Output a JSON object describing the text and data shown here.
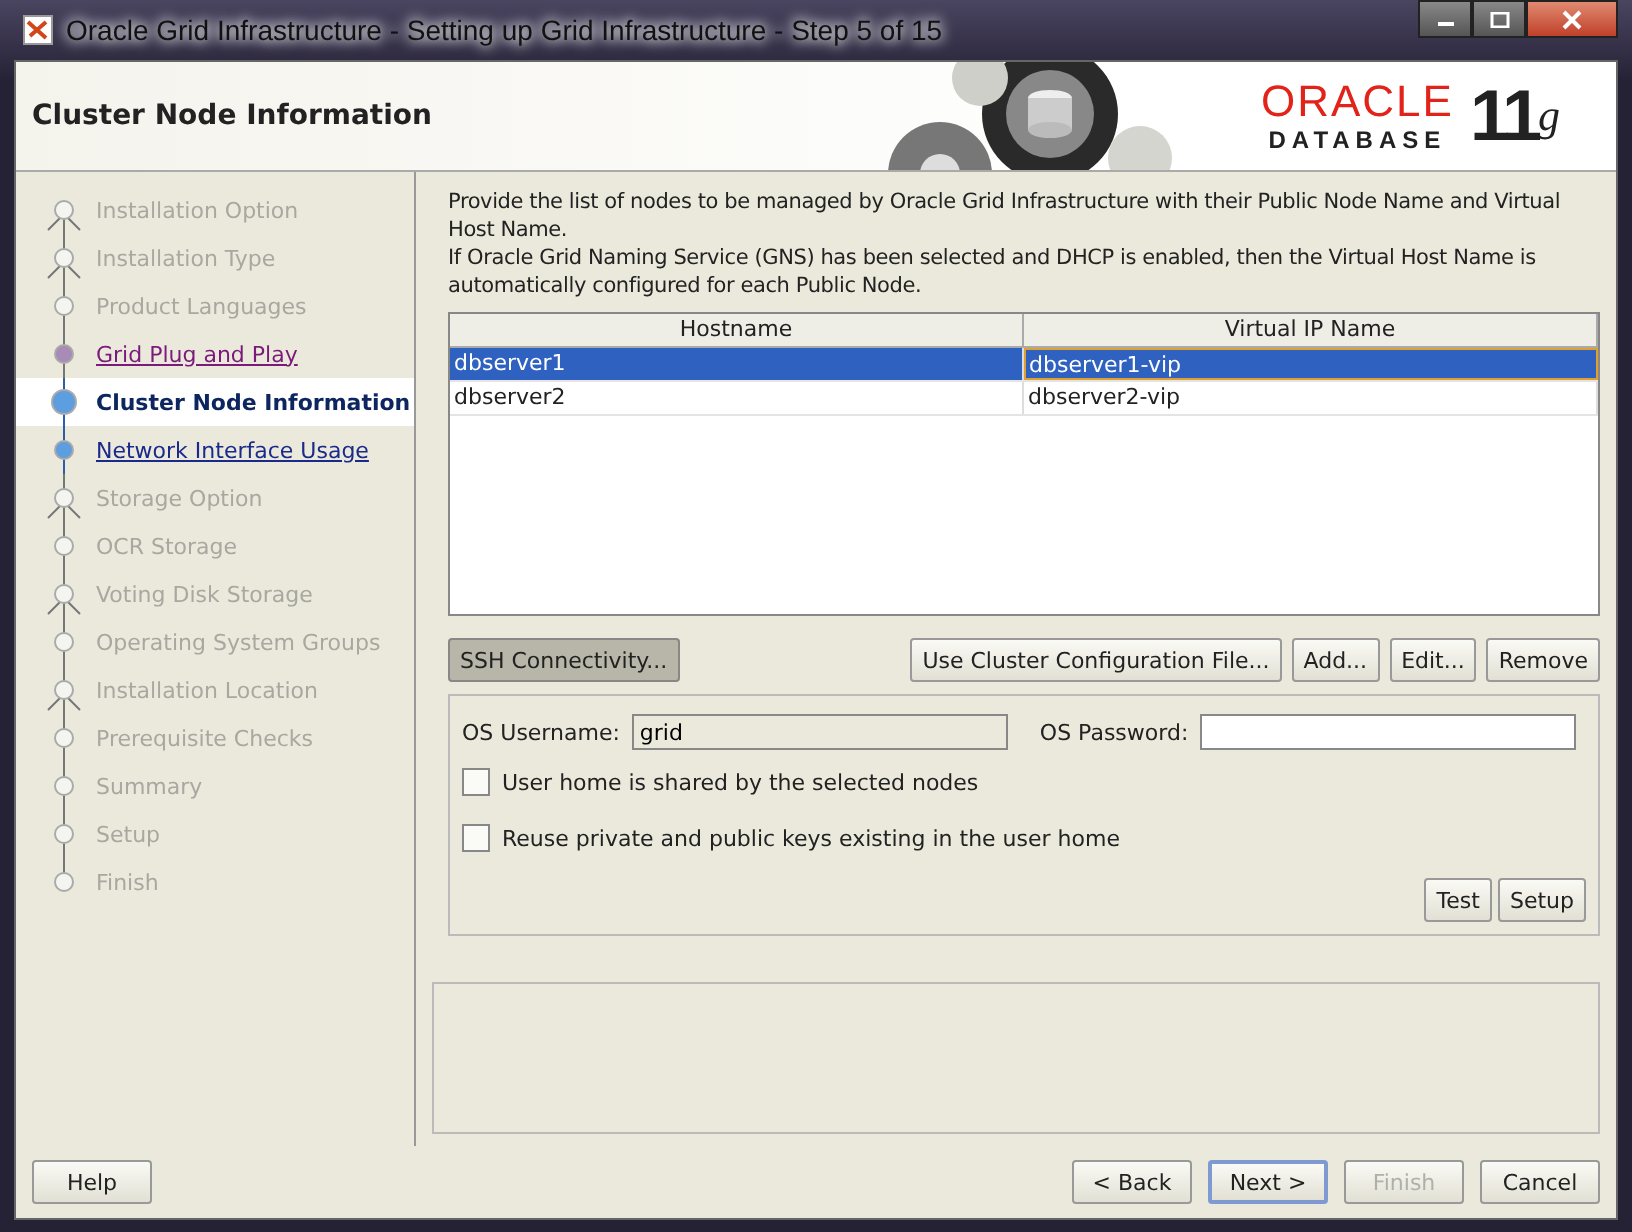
{
  "window": {
    "title": "Oracle Grid Infrastructure - Setting up Grid Infrastructure - Step 5 of 15"
  },
  "header": {
    "title": "Cluster Node Information",
    "logo_brand": "ORACLE",
    "logo_product": "DATABASE",
    "logo_version": "11",
    "logo_suffix": "g"
  },
  "steps": [
    {
      "label": "Installation Option",
      "selected": false,
      "visited": false,
      "enabled": false,
      "kind": "branch"
    },
    {
      "label": "Installation Type",
      "selected": false,
      "visited": false,
      "enabled": false,
      "kind": "branch"
    },
    {
      "label": "Product Languages",
      "selected": false,
      "visited": false,
      "enabled": false,
      "kind": "step"
    },
    {
      "label": "Grid Plug and Play",
      "selected": false,
      "visited": true,
      "enabled": true,
      "kind": "step"
    },
    {
      "label": "Cluster Node Information",
      "selected": true,
      "visited": false,
      "enabled": true,
      "kind": "step"
    },
    {
      "label": "Network Interface Usage",
      "selected": false,
      "visited": false,
      "enabled": true,
      "kind": "step"
    },
    {
      "label": "Storage Option",
      "selected": false,
      "visited": false,
      "enabled": false,
      "kind": "branch"
    },
    {
      "label": "OCR Storage",
      "selected": false,
      "visited": false,
      "enabled": false,
      "kind": "step"
    },
    {
      "label": "Voting Disk Storage",
      "selected": false,
      "visited": false,
      "enabled": false,
      "kind": "branch"
    },
    {
      "label": "Operating System Groups",
      "selected": false,
      "visited": false,
      "enabled": false,
      "kind": "step"
    },
    {
      "label": "Installation Location",
      "selected": false,
      "visited": false,
      "enabled": false,
      "kind": "branch"
    },
    {
      "label": "Prerequisite Checks",
      "selected": false,
      "visited": false,
      "enabled": false,
      "kind": "step"
    },
    {
      "label": "Summary",
      "selected": false,
      "visited": false,
      "enabled": false,
      "kind": "step"
    },
    {
      "label": "Setup",
      "selected": false,
      "visited": false,
      "enabled": false,
      "kind": "step"
    },
    {
      "label": "Finish",
      "selected": false,
      "visited": false,
      "enabled": false,
      "kind": "step"
    }
  ],
  "description": [
    "Provide the list of nodes to be managed by Oracle Grid Infrastructure with their Public Node Name and Virtual Host Name.",
    "If Oracle Grid Naming Service (GNS) has been selected and DHCP is enabled, then the Virtual Host Name is automatically configured for each Public Node."
  ],
  "table": {
    "columns": [
      "Hostname",
      "Virtual IP Name"
    ],
    "rows": [
      {
        "cells": [
          "dbserver1",
          "dbserver1-vip"
        ],
        "selected": true
      },
      {
        "cells": [
          "dbserver2",
          "dbserver2-vip"
        ],
        "selected": false
      }
    ]
  },
  "ssh_button": {
    "label": "SSH Connectivity...",
    "pressed": true
  },
  "table_buttons": [
    "Use Cluster Configuration File...",
    "Add...",
    "Edit...",
    "Remove"
  ],
  "ssh_panel": {
    "username_label": "OS Username:",
    "username": "grid",
    "password_label": "OS Password:",
    "checkboxes": [
      {
        "label": "User home is shared by the selected nodes",
        "checked": false
      },
      {
        "label": "Reuse private and public keys existing in the user home",
        "checked": false
      }
    ],
    "buttons": [
      "Test",
      "Setup"
    ]
  },
  "footer": {
    "help": "Help",
    "buttons": [
      {
        "label": "< Back",
        "disabled": false,
        "default": false
      },
      {
        "label": "Next >",
        "disabled": false,
        "default": true
      },
      {
        "label": "Finish",
        "disabled": true,
        "default": false
      },
      {
        "label": "Cancel",
        "disabled": false,
        "default": false
      }
    ]
  }
}
